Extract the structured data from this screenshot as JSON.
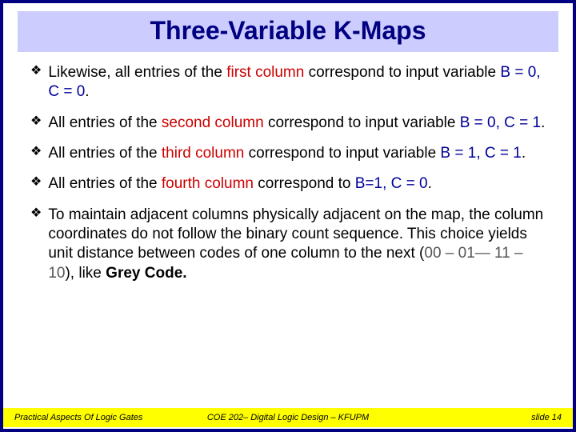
{
  "title": "Three-Variable K-Maps",
  "bullets": [
    {
      "prefix": "Likewise, all entries of the ",
      "ord": "first column",
      "mid": " correspond to input variable ",
      "assign": "B = 0, C = 0",
      "suffix": "."
    },
    {
      "prefix": "All entries of the ",
      "ord": "second column",
      "mid": " correspond to input variable ",
      "assign": "B = 0, C = 1",
      "suffix": "."
    },
    {
      "prefix": "All entries of the ",
      "ord": "third column",
      "mid": " correspond to input variable ",
      "assign": "B = 1, C = 1",
      "suffix": "."
    },
    {
      "prefix": "All entries of the ",
      "ord": "fourth column",
      "mid": " correspond to ",
      "assign": "B=1, C = 0",
      "suffix": "."
    }
  ],
  "final": {
    "part1": "To maintain adjacent columns physically adjacent on the map, the column coordinates do not follow the binary count sequence. This choice yields unit distance between codes of one column to the next (",
    "codes": "00 – 01— 11 – 10",
    "part2": "), like ",
    "grey": "Grey Code",
    "part3": "."
  },
  "footer": {
    "left": "Practical Aspects Of Logic Gates",
    "center": "COE 202– Digital Logic Design – KFUPM",
    "right": "slide 14"
  }
}
